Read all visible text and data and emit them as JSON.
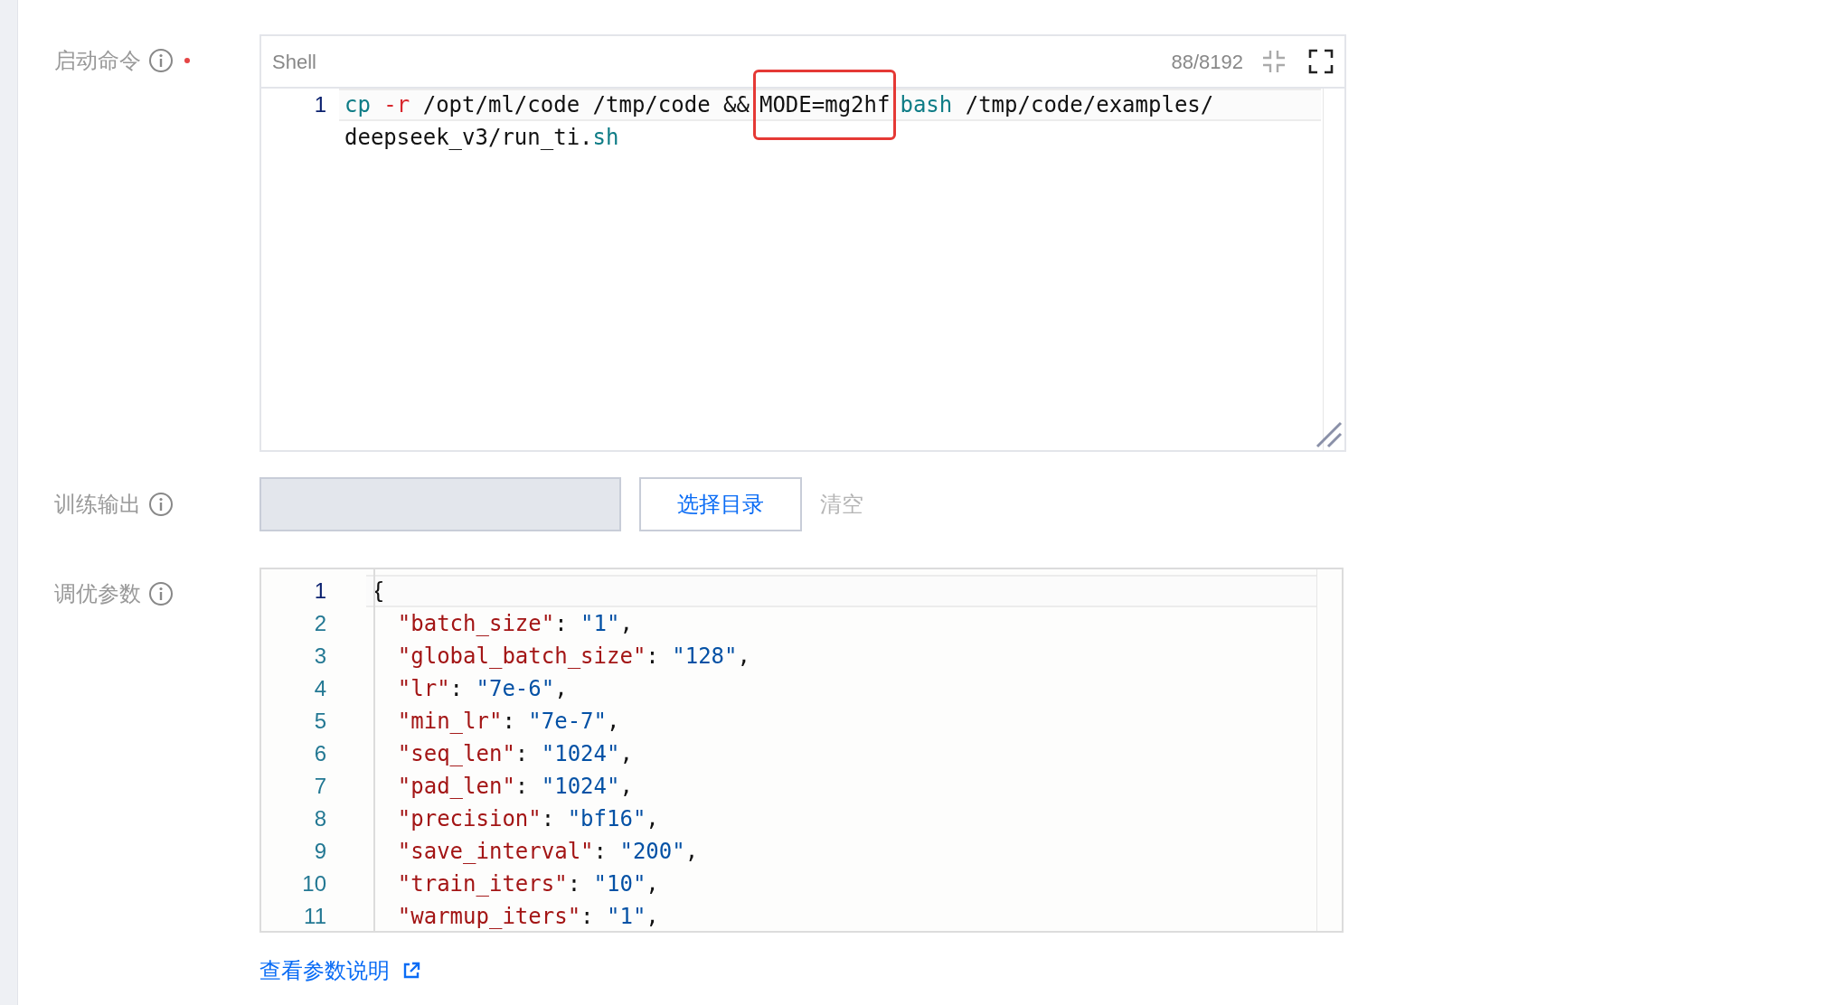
{
  "command": {
    "label": "启动命令",
    "required": true,
    "language": "Shell",
    "counter": "88/8192",
    "lines": [
      {
        "number": "1",
        "active": true,
        "tokens": [
          {
            "kind": "keyword",
            "text": "cp"
          },
          {
            "kind": "flag",
            "text": " -r"
          },
          {
            "kind": "plain",
            "text": " /opt/ml/code /tmp/code &&"
          },
          {
            "kind": "plain",
            "text": "MODE=mg2hf",
            "highlighted": true
          },
          {
            "kind": "keyword",
            "text": "bash"
          },
          {
            "kind": "plain",
            "text": " /tmp/code/examples/"
          }
        ]
      },
      {
        "tokens": [
          {
            "kind": "plain",
            "text": "deepseek_v3/run_ti."
          },
          {
            "kind": "keyword",
            "text": "sh"
          }
        ]
      }
    ]
  },
  "output": {
    "label": "训练输出",
    "button": "选择目录",
    "clear": "清空"
  },
  "params": {
    "label": "调优参数",
    "lines": [
      {
        "number": "1",
        "active": true,
        "tokens": [
          {
            "kind": "punct",
            "text": "{"
          }
        ],
        "children": [
          {
            "number": "2",
            "tokens": [
              {
                "kind": "key",
                "text": "\"batch_size\""
              },
              {
                "kind": "punct",
                "text": ": "
              },
              {
                "kind": "string",
                "text": "\"1\""
              },
              {
                "kind": "punct",
                "text": ","
              }
            ]
          },
          {
            "number": "3",
            "tokens": [
              {
                "kind": "key",
                "text": "\"global_batch_size\""
              },
              {
                "kind": "punct",
                "text": ": "
              },
              {
                "kind": "string",
                "text": "\"128\""
              },
              {
                "kind": "punct",
                "text": ","
              }
            ]
          },
          {
            "number": "4",
            "tokens": [
              {
                "kind": "key",
                "text": "\"lr\""
              },
              {
                "kind": "punct",
                "text": ": "
              },
              {
                "kind": "string",
                "text": "\"7e-6\""
              },
              {
                "kind": "punct",
                "text": ","
              }
            ]
          },
          {
            "number": "5",
            "tokens": [
              {
                "kind": "key",
                "text": "\"min_lr\""
              },
              {
                "kind": "punct",
                "text": ": "
              },
              {
                "kind": "string",
                "text": "\"7e-7\""
              },
              {
                "kind": "punct",
                "text": ","
              }
            ]
          },
          {
            "number": "6",
            "tokens": [
              {
                "kind": "key",
                "text": "\"seq_len\""
              },
              {
                "kind": "punct",
                "text": ": "
              },
              {
                "kind": "string",
                "text": "\"1024\""
              },
              {
                "kind": "punct",
                "text": ","
              }
            ]
          },
          {
            "number": "7",
            "tokens": [
              {
                "kind": "key",
                "text": "\"pad_len\""
              },
              {
                "kind": "punct",
                "text": ": "
              },
              {
                "kind": "string",
                "text": "\"1024\""
              },
              {
                "kind": "punct",
                "text": ","
              }
            ]
          },
          {
            "number": "8",
            "tokens": [
              {
                "kind": "key",
                "text": "\"precision\""
              },
              {
                "kind": "punct",
                "text": ": "
              },
              {
                "kind": "string",
                "text": "\"bf16\""
              },
              {
                "kind": "punct",
                "text": ","
              }
            ]
          },
          {
            "number": "9",
            "tokens": [
              {
                "kind": "key",
                "text": "\"save_interval\""
              },
              {
                "kind": "punct",
                "text": ": "
              },
              {
                "kind": "string",
                "text": "\"200\""
              },
              {
                "kind": "punct",
                "text": ","
              }
            ]
          },
          {
            "number": "10",
            "tokens": [
              {
                "kind": "key",
                "text": "\"train_iters\""
              },
              {
                "kind": "punct",
                "text": ": "
              },
              {
                "kind": "string",
                "text": "\"10\""
              },
              {
                "kind": "punct",
                "text": ","
              }
            ]
          },
          {
            "number": "11",
            "tokens": [
              {
                "kind": "key",
                "text": "\"warmup_iters\""
              },
              {
                "kind": "punct",
                "text": ": "
              },
              {
                "kind": "string",
                "text": "\"1\""
              },
              {
                "kind": "punct",
                "text": ","
              }
            ]
          }
        ]
      }
    ],
    "link": "查看参数说明"
  }
}
